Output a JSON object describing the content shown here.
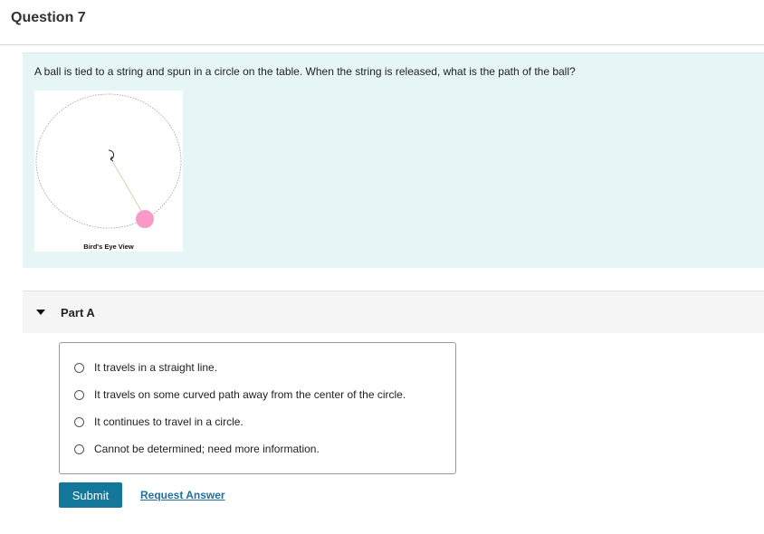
{
  "question": {
    "title": "Question 7",
    "prompt": "A ball is tied to a string and spun in a circle on the table. When the string is released, what is the path of the ball?",
    "figure_caption": "Bird's Eye View"
  },
  "part": {
    "label": "Part A",
    "options": [
      "It travels in a straight line.",
      "It travels on some curved path away from the center of the circle.",
      "It continues to travel in a circle.",
      "Cannot be determined; need more information."
    ],
    "submit_label": "Submit",
    "request_label": "Request Answer"
  },
  "colors": {
    "panel_bg": "#e6f5f5",
    "submit_bg": "#137799",
    "link": "#1f6fa0",
    "ball": "#f79ac8"
  }
}
